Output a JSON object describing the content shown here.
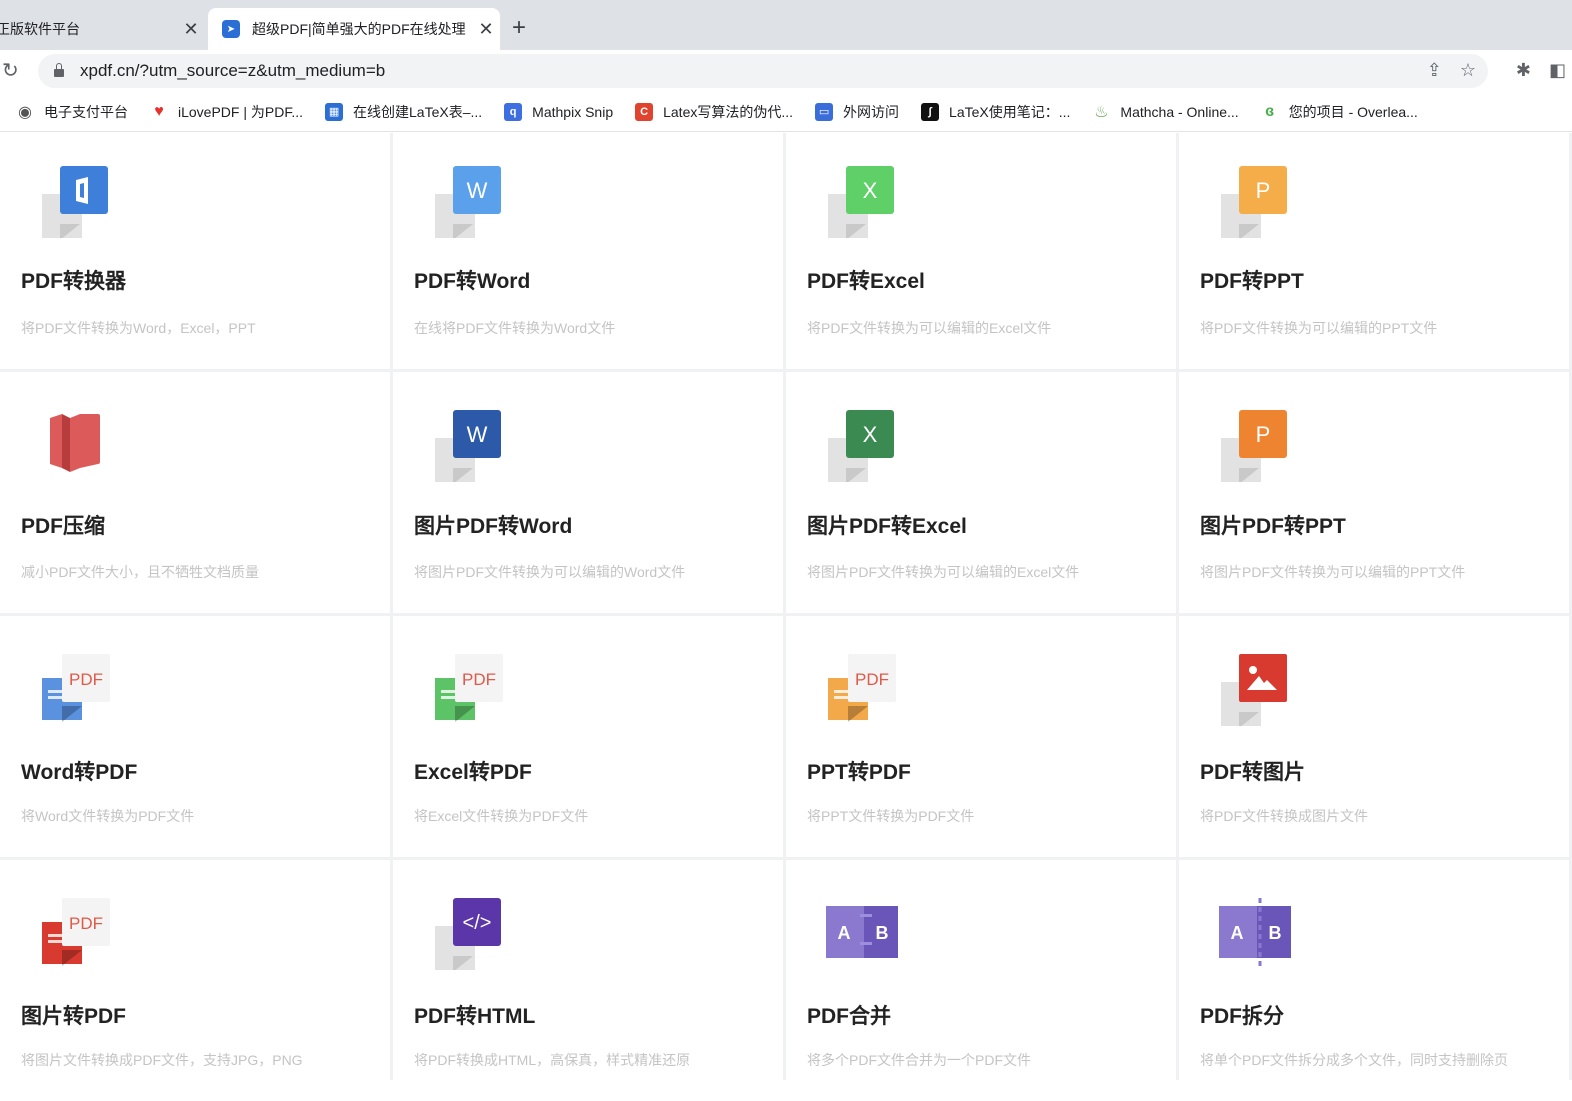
{
  "tabs": [
    {
      "title": "正版软件平台",
      "close": "✕"
    },
    {
      "title": "超级PDF|简单强大的PDF在线处理",
      "close": "✕"
    }
  ],
  "new_tab": "+",
  "address": {
    "url": "xpdf.cn/?utm_source=z&utm_medium=b"
  },
  "bookmarks": [
    {
      "label": "电子支付平台",
      "color": "#555555",
      "icon": "globe-icon"
    },
    {
      "label": "iLovePDF | 为PDF...",
      "color": "#e5322d",
      "icon": "heart-icon"
    },
    {
      "label": "在线创建LaTeX表–...",
      "color": "#2b6fd6",
      "icon": "table-icon"
    },
    {
      "label": "Mathpix Snip",
      "color": "#3d6fe0",
      "icon": "mathpix-icon"
    },
    {
      "label": "Latex写算法的伪代...",
      "color": "#e0442f",
      "icon": "csdn-icon"
    },
    {
      "label": "外网访问",
      "color": "#3b6dd8",
      "icon": "vpn-icon"
    },
    {
      "label": "LaTeX使用笔记：...",
      "color": "#111111",
      "icon": "integral-icon"
    },
    {
      "label": "Mathcha - Online...",
      "color": "#6aa84f",
      "icon": "mathcha-icon"
    },
    {
      "label": "您的项目 - Overlea...",
      "color": "#4caf50",
      "icon": "overleaf-icon"
    }
  ],
  "tools": [
    {
      "title": "PDF转换器",
      "desc": "将PDF文件转换为Word，Excel，PPT",
      "icon": "office-icon",
      "color": "#3d7fd9"
    },
    {
      "title": "PDF转Word",
      "desc": "在线将PDF文件转换为Word文件",
      "icon": "word-icon",
      "color": "#5aa0ea",
      "letter": "W"
    },
    {
      "title": "PDF转Excel",
      "desc": "将PDF文件转换为可以编辑的Excel文件",
      "icon": "excel-icon",
      "color": "#5fcf68",
      "letter": "X"
    },
    {
      "title": "PDF转PPT",
      "desc": "将PDF文件转换为可以编辑的PPT文件",
      "icon": "ppt-icon",
      "color": "#f5ad4a",
      "letter": "P"
    },
    {
      "title": "PDF压缩",
      "desc": "减小PDF文件大小，且不牺牲文档质量",
      "icon": "compress-icon",
      "color": "#dc5a5a"
    },
    {
      "title": "图片PDF转Word",
      "desc": "将图片PDF文件转换为可以编辑的Word文件",
      "icon": "word-icon",
      "color": "#2c5aa8",
      "letter": "W"
    },
    {
      "title": "图片PDF转Excel",
      "desc": "将图片PDF文件转换为可以编辑的Excel文件",
      "icon": "excel-icon",
      "color": "#3a8a52",
      "letter": "X"
    },
    {
      "title": "图片PDF转PPT",
      "desc": "将图片PDF文件转换为可以编辑的PPT文件",
      "icon": "ppt-icon",
      "color": "#ef8430",
      "letter": "P"
    },
    {
      "title": "Word转PDF",
      "desc": "将Word文件转换为PDF文件",
      "icon": "pdf-doc-icon",
      "color": "#5a92e0",
      "letter": "PDF"
    },
    {
      "title": "Excel转PDF",
      "desc": "将Excel文件转换为PDF文件",
      "icon": "pdf-doc-icon",
      "color": "#5cc466",
      "letter": "PDF"
    },
    {
      "title": "PPT转PDF",
      "desc": "将PPT文件转换为PDF文件",
      "icon": "pdf-doc-icon",
      "color": "#f3a94a",
      "letter": "PDF"
    },
    {
      "title": "PDF转图片",
      "desc": "将PDF文件转换成图片文件",
      "icon": "image-icon",
      "color": "#d93a30"
    },
    {
      "title": "图片转PDF",
      "desc": "将图片文件转换成PDF文件，支持JPG，PNG",
      "icon": "pdf-doc-icon",
      "color": "#d93a30",
      "letter": "PDF"
    },
    {
      "title": "PDF转HTML",
      "desc": "将PDF转换成HTML，高保真，样式精准还原",
      "icon": "code-icon",
      "color": "#5b36a8"
    },
    {
      "title": "PDF合并",
      "desc": "将多个PDF文件合并为一个PDF文件",
      "icon": "merge-icon",
      "color": "#8a79cf",
      "letter": "A B"
    },
    {
      "title": "PDF拆分",
      "desc": "将单个PDF文件拆分成多个文件，同时支持删除页",
      "icon": "split-icon",
      "color": "#8a79cf",
      "letter": "A B"
    }
  ]
}
